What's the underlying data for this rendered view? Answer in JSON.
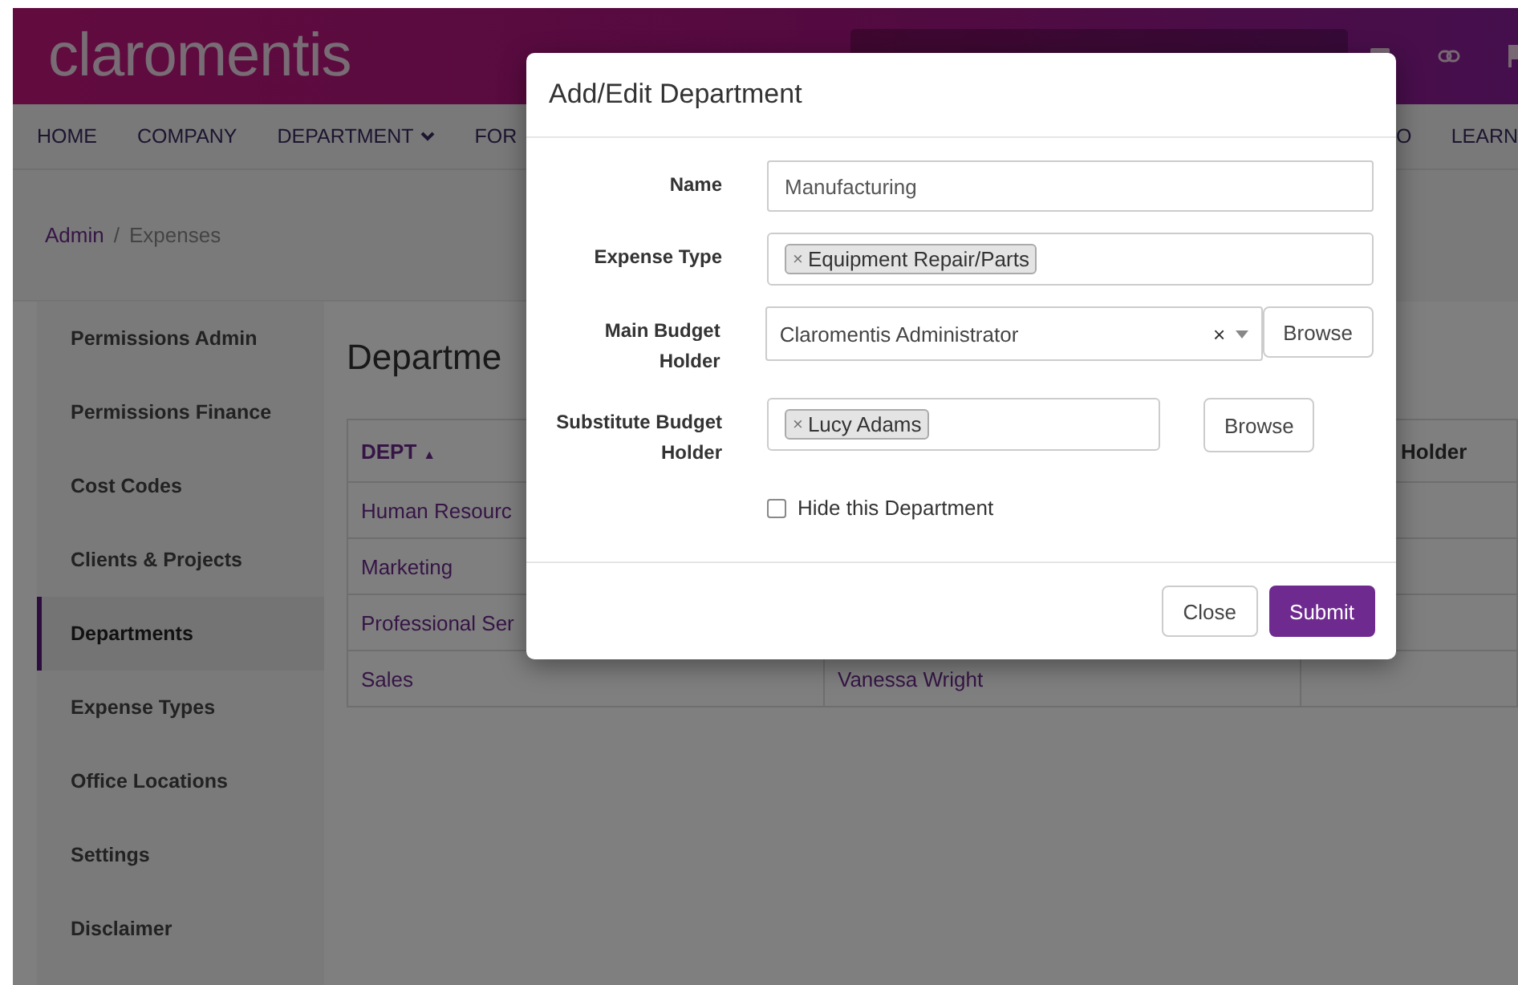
{
  "header": {
    "logo": "claromentis"
  },
  "nav": [
    {
      "label": "HOME"
    },
    {
      "label": "COMPANY"
    },
    {
      "label": "DEPARTMENT",
      "dropdown": true
    },
    {
      "label": "FOR"
    },
    {
      "label": "O"
    },
    {
      "label": "LEARN"
    }
  ],
  "breadcrumb": {
    "link": "Admin",
    "separator": "/",
    "current": "Expenses"
  },
  "sidebar": {
    "items": [
      {
        "label": "Permissions Admin",
        "selected": false
      },
      {
        "label": "Permissions Finance",
        "selected": false
      },
      {
        "label": "Cost Codes",
        "selected": false
      },
      {
        "label": "Clients & Projects",
        "selected": false
      },
      {
        "label": "Departments",
        "selected": true
      },
      {
        "label": "Expense Types",
        "selected": false
      },
      {
        "label": "Office Locations",
        "selected": false
      },
      {
        "label": "Settings",
        "selected": false
      },
      {
        "label": "Disclaimer",
        "selected": false
      }
    ]
  },
  "page_title": "Departme",
  "table": {
    "columns": [
      {
        "label": "DEPT",
        "sort": "▲"
      },
      {},
      {
        "label": "Holder"
      }
    ],
    "rows": [
      [
        "Human Resourc",
        "",
        ""
      ],
      [
        "Marketing",
        "",
        ""
      ],
      [
        "Professional Ser",
        "",
        ""
      ],
      [
        "Sales",
        "Vanessa Wright",
        ""
      ]
    ]
  },
  "dialog": {
    "title": "Add/Edit Department",
    "fields": [
      {
        "kind": "text",
        "label": "Name",
        "value": "Manufacturing"
      },
      {
        "kind": "tags",
        "label": "Expense Type",
        "tags": [
          "Equipment Repair/Parts"
        ],
        "tag_remove": "×"
      },
      {
        "kind": "select",
        "label": "Main Budget Holder",
        "value": "Claromentis Administrator",
        "clear": "×",
        "button": "Browse"
      },
      {
        "kind": "tags_browse",
        "label": "Substitute Budget Holder",
        "tags": [
          "Lucy Adams"
        ],
        "tag_remove": "×",
        "button": "Browse"
      },
      {
        "kind": "checkbox",
        "label": "Hide this Department",
        "checked": false
      }
    ],
    "buttons": [
      {
        "label": "Close",
        "primary": false
      },
      {
        "label": "Submit",
        "primary": true
      }
    ]
  }
}
